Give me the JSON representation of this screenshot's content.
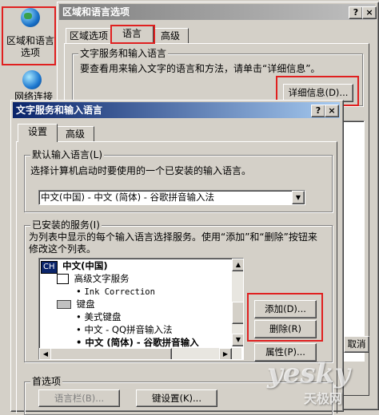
{
  "desktop": {
    "icon1_label": "区域和语言\n选项",
    "icon2_label": "网络连接"
  },
  "back_dialog": {
    "title": "区域和语言选项",
    "tabs": [
      "区域选项",
      "语言",
      "高级"
    ],
    "group_title": "文字服务和输入语言",
    "description": "要查看用来输入文字的语言和方法，请单击“详细信息”。",
    "details_button": "详细信息(D)...",
    "cancel_partial": "取消"
  },
  "front_dialog": {
    "title": "文字服务和输入语言",
    "tabs": [
      "设置",
      "高级"
    ],
    "default_group": {
      "title": "默认输入语言(L)",
      "description": "选择计算机启动时要使用的一个已安装的输入语言。",
      "selected": "中文(中国) - 中文 (简体) - 谷歌拼音输入法"
    },
    "installed_group": {
      "title": "已安装的服务(I)",
      "description": "为列表中显示的每个输入语言选择服务。使用“添加”和“删除”按钮来修改这个列表。",
      "tree": {
        "lang_code": "CH",
        "language": "中文(中国)",
        "advanced_service": "高级文字服务",
        "ink": "Ink Correction",
        "keyboard": "键盘",
        "kb_items": [
          "美式键盘",
          "中文 - QQ拼音输入法",
          "中文 (简体) - 谷歌拼音输入"
        ]
      },
      "add_button": "添加(D)...",
      "remove_button": "删除(R)",
      "properties_button": "属性(P)..."
    },
    "prefs_group": {
      "title": "首选项",
      "langbar_button": "语言栏(B)...",
      "keysettings_button": "键设置(K)..."
    }
  },
  "watermark": {
    "brand": "yesky",
    "sub": "天极网"
  },
  "colors": {
    "titlebar_active": "#0a246a",
    "titlebar_inactive": "#808080",
    "highlight": "#e02020"
  }
}
